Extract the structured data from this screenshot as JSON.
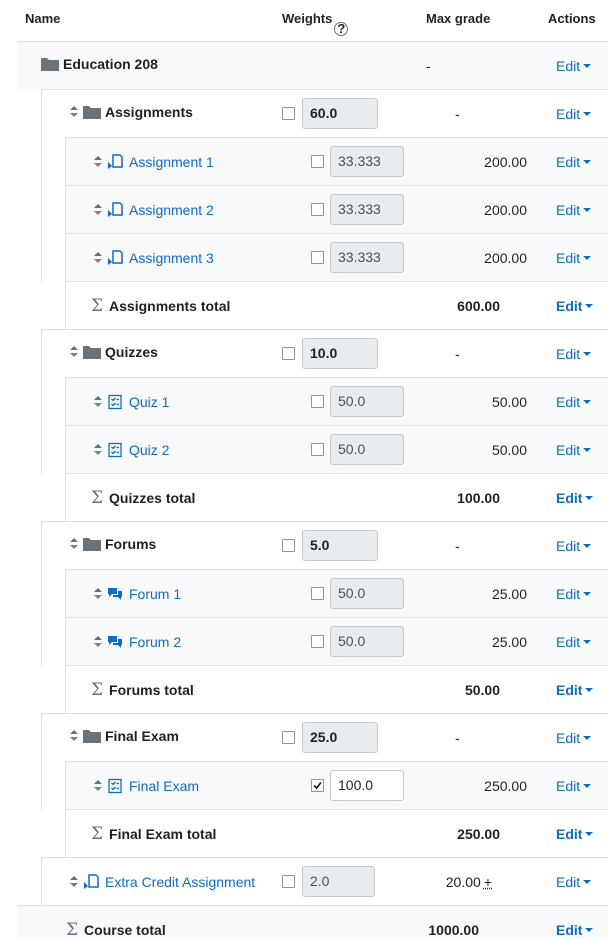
{
  "header": {
    "name": "Name",
    "weights": "Weights",
    "help": "?",
    "max_grade": "Max grade",
    "actions": "Actions"
  },
  "course": {
    "name": "Education 208",
    "max": "-",
    "edit": "Edit"
  },
  "categories": [
    {
      "name": "Assignments",
      "weight": "60.0",
      "max": "-",
      "edit": "Edit",
      "items": [
        {
          "name": "Assignment 1",
          "icon": "assignment-icon",
          "weight": "33.333",
          "max": "200.00",
          "edit": "Edit"
        },
        {
          "name": "Assignment 2",
          "icon": "assignment-icon",
          "weight": "33.333",
          "max": "200.00",
          "edit": "Edit"
        },
        {
          "name": "Assignment 3",
          "icon": "assignment-icon",
          "weight": "33.333",
          "max": "200.00",
          "edit": "Edit"
        }
      ],
      "total_label": "Assignments total",
      "total_max": "600.00",
      "total_edit": "Edit"
    },
    {
      "name": "Quizzes",
      "weight": "10.0",
      "max": "-",
      "edit": "Edit",
      "items": [
        {
          "name": "Quiz 1",
          "icon": "quiz-icon",
          "weight": "50.0",
          "max": "50.00",
          "edit": "Edit"
        },
        {
          "name": "Quiz 2",
          "icon": "quiz-icon",
          "weight": "50.0",
          "max": "50.00",
          "edit": "Edit"
        }
      ],
      "total_label": "Quizzes total",
      "total_max": "100.00",
      "total_edit": "Edit"
    },
    {
      "name": "Forums",
      "weight": "5.0",
      "max": "-",
      "edit": "Edit",
      "items": [
        {
          "name": "Forum 1",
          "icon": "forum-icon",
          "weight": "50.0",
          "max": "25.00",
          "edit": "Edit"
        },
        {
          "name": "Forum 2",
          "icon": "forum-icon",
          "weight": "50.0",
          "max": "25.00",
          "edit": "Edit"
        }
      ],
      "total_label": "Forums total",
      "total_max": "50.00",
      "total_edit": "Edit"
    },
    {
      "name": "Final Exam",
      "weight": "25.0",
      "max": "-",
      "edit": "Edit",
      "items": [
        {
          "name": "Final Exam",
          "icon": "quiz-icon",
          "weight": "100.0",
          "max": "250.00",
          "edit": "Edit",
          "override": true
        }
      ],
      "total_label": "Final Exam total",
      "total_max": "250.00",
      "total_edit": "Edit"
    }
  ],
  "extra": {
    "name": "Extra Credit Assignment",
    "icon": "assignment-icon",
    "weight": "2.0",
    "max": "20.00",
    "plus": "+",
    "edit": "Edit"
  },
  "course_total": {
    "label": "Course total",
    "max": "1000.00",
    "edit": "Edit"
  },
  "colors": {
    "link": "#0f6cbf",
    "row_alt": "#f8f9fa",
    "border": "#dee2e6",
    "icon_blue": "#0f6cbf",
    "folder": "#6a737b"
  }
}
